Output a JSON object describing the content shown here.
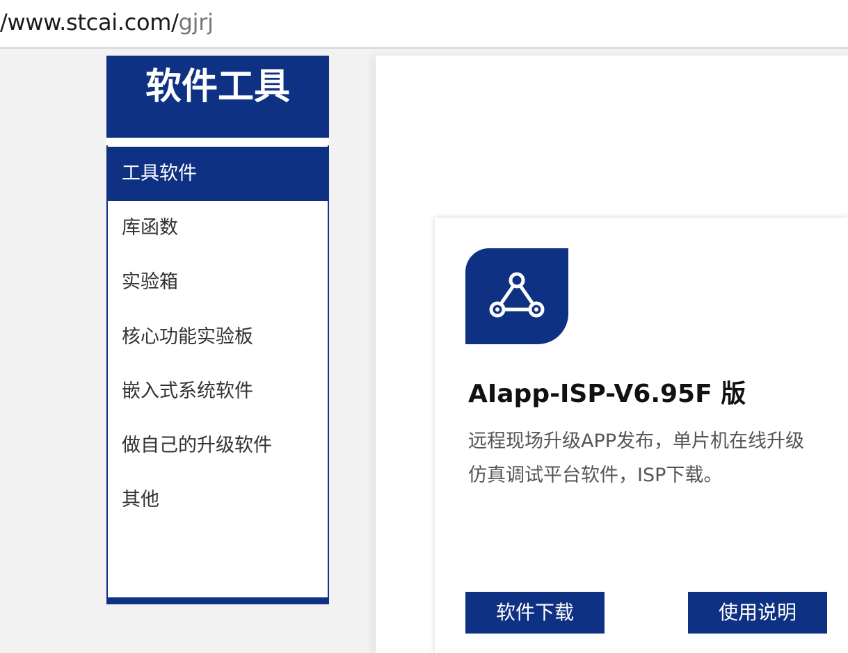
{
  "address_bar": {
    "url_host": "/www.stcai.com/",
    "url_path": "gjrj"
  },
  "sidebar": {
    "title": "软件工具",
    "items": [
      {
        "label": "工具软件",
        "active": true
      },
      {
        "label": "库函数",
        "active": false
      },
      {
        "label": "实验箱",
        "active": false
      },
      {
        "label": "核心功能实验板",
        "active": false
      },
      {
        "label": "嵌入式系统软件",
        "active": false
      },
      {
        "label": "做自己的升级软件",
        "active": false
      },
      {
        "label": "其他",
        "active": false
      }
    ]
  },
  "card": {
    "icon": "share-network-icon",
    "title": "AIapp-ISP-V6.95F 版",
    "description_line1": "远程现场升级APP发布，单片机在线升级",
    "description_line2": "仿真调试平台软件，ISP下载。",
    "download_label": "软件下载",
    "manual_label": "使用说明"
  },
  "colors": {
    "brand_blue": "#0f3183",
    "page_background": "#f2f2f2"
  }
}
